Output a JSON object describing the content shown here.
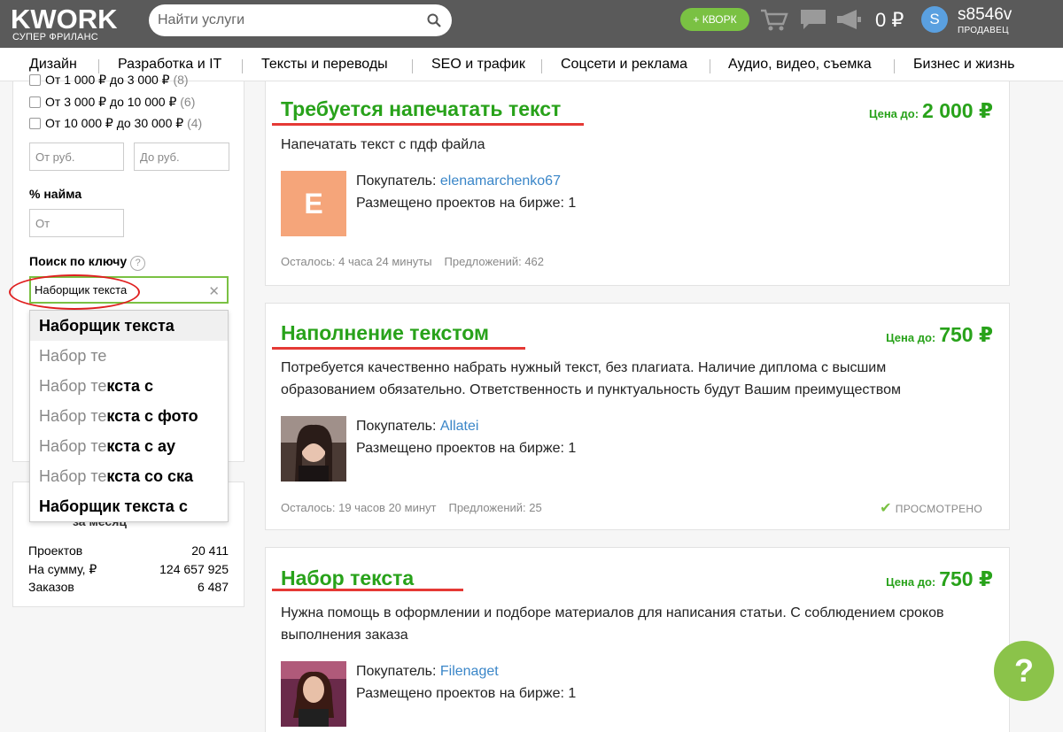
{
  "header": {
    "logo_text": "KWORK",
    "logo_subtitle": "СУПЕР ФРИЛАНС",
    "search_placeholder": "Найти услуги",
    "kwork_button": "+ КВОРК",
    "balance": "0 ₽",
    "avatar_letter": "S",
    "username": "s8546v",
    "role": "ПРОДАВЕЦ"
  },
  "categories": [
    "Дизайн",
    "Разработка и IT",
    "Тексты и переводы",
    "SEO и трафик",
    "Соцсети и реклама",
    "Аудио, видео, съемка",
    "Бизнес и жизнь"
  ],
  "filters": {
    "price_ranges": [
      {
        "label": "От 1 000 ₽ до 3 000 ₽",
        "count": "(8)"
      },
      {
        "label": "От 3 000 ₽ до 10 000 ₽",
        "count": "(6)"
      },
      {
        "label": "От 10 000 ₽ до 30 000 ₽",
        "count": "(4)"
      }
    ],
    "price_from_placeholder": "От руб.",
    "price_to_placeholder": "До руб.",
    "hire_label": "% найма",
    "hire_placeholder": "От",
    "key_label": "Поиск по ключу",
    "key_value": "Наборщик текста",
    "suggestions": [
      {
        "typed": "",
        "completion": "Наборщик текста"
      },
      {
        "typed": "Набор те",
        "completion": ""
      },
      {
        "typed": "Набор те",
        "completion": "кста с"
      },
      {
        "typed": "Набор те",
        "completion": "кста с фото"
      },
      {
        "typed": "Набор те",
        "completion": "кста с ау"
      },
      {
        "typed": "Набор те",
        "completion": "кста со ска"
      },
      {
        "typed": "",
        "completion": "Наборщик текста с"
      }
    ]
  },
  "stats": {
    "partial_heading": "за месяц",
    "rows": [
      {
        "label": "Проектов",
        "value": "20 411"
      },
      {
        "label": "На сумму, ₽",
        "value": "124 657 925"
      },
      {
        "label": "Заказов",
        "value": "6 487"
      }
    ]
  },
  "projects": [
    {
      "title": "Требуется напечатать текст",
      "price_label": "Цена до:",
      "price": "2 000 ₽",
      "description": "Напечатать текст с пдф файла",
      "avatar_letter": "E",
      "buyer_label": "Покупатель:",
      "buyer": "elenamarchenko67",
      "posted": "Размещено проектов на бирже: 1",
      "time_left": "Осталось: 4 часа 24 минуты",
      "offers": "Предложений: 462",
      "viewed": ""
    },
    {
      "title": "Наполнение текстом",
      "price_label": "Цена до:",
      "price": "750 ₽",
      "description": "Потребуется качественно набрать нужный текст, без плагиата. Наличие диплома с высшим образованием обязательно. Ответственность и пунктуальность будут Вашим преимуществом",
      "avatar_letter": "",
      "buyer_label": "Покупатель:",
      "buyer": "Allatei",
      "posted": "Размещено проектов на бирже: 1",
      "time_left": "Осталось: 19 часов 20 минут",
      "offers": "Предложений: 25",
      "viewed": "ПРОСМОТРЕНО"
    },
    {
      "title": "Набор текста",
      "price_label": "Цена до:",
      "price": "750 ₽",
      "description": "Нужна помощь в оформлении и подборе материалов для написания статьи. С соблюдением сроков выполнения заказа",
      "avatar_letter": "",
      "buyer_label": "Покупатель:",
      "buyer": "Filenaget",
      "posted": "Размещено проектов на бирже: 1",
      "time_left": "",
      "offers": "",
      "viewed": ""
    }
  ],
  "help_label": "?",
  "colors": {
    "header_bg": "#5a5a5a",
    "accent_green": "#28a21a",
    "button_green": "#7ac143",
    "link_blue": "#3a86c8",
    "annotation_red": "#e53935"
  }
}
